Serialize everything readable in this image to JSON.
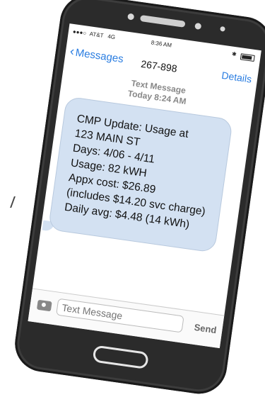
{
  "status_bar": {
    "carrier": "AT&T",
    "network": "4G",
    "time": "8:36 AM"
  },
  "nav": {
    "back_label": "Messages",
    "contact": "267-898",
    "details_label": "Details"
  },
  "thread": {
    "label": "Text Message",
    "timestamp": "Today 8:24 AM"
  },
  "message": {
    "lines": [
      "CMP Update: Usage at",
      "123 MAIN ST",
      "Days: 4/06 - 4/11",
      "Usage: 82 kWH",
      "Appx cost: $26.89",
      "(includes $14.20 svc charge)",
      "Daily avg: $4.48 (14 kWh)"
    ]
  },
  "composer": {
    "placeholder": "Text Message",
    "send_label": "Send"
  },
  "colors": {
    "accent": "#2a7de1",
    "bubble": "#d3e1f2",
    "phone_body": "#2b2b2b"
  },
  "icons": {
    "camera": "camera-icon",
    "back": "chevron-left-icon"
  }
}
